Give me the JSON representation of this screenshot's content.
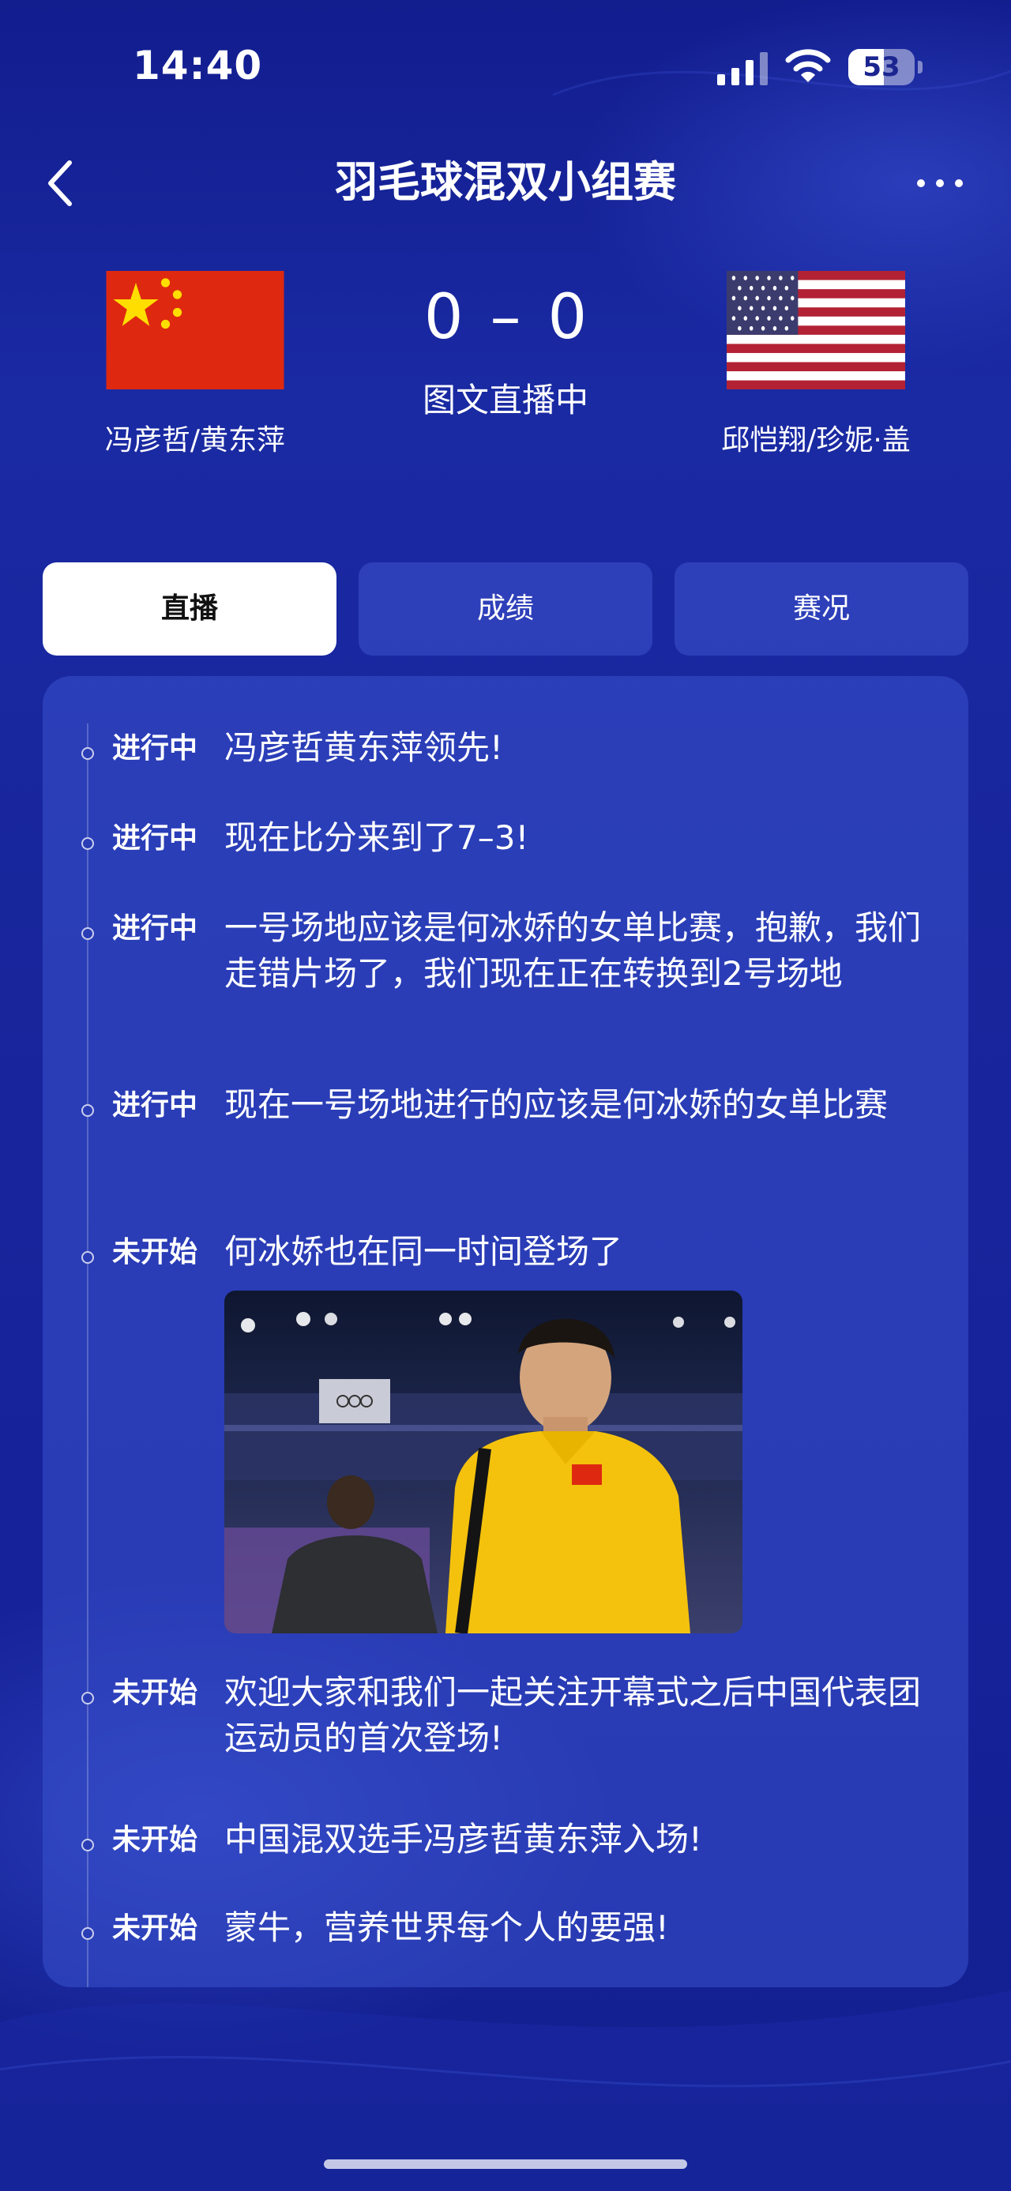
{
  "status_bar": {
    "time": "14:40",
    "battery": "53",
    "battery_level": 0.53
  },
  "nav": {
    "title": "羽毛球混双小组赛"
  },
  "match": {
    "home_team": "冯彦哲/黄东萍",
    "away_team": "邱恺翔/珍妮·盖",
    "home_score": "0",
    "score_separator": "–",
    "away_score": "0",
    "status": "图文直播中"
  },
  "tabs": [
    {
      "label": "直播",
      "active": true
    },
    {
      "label": "成绩",
      "active": false
    },
    {
      "label": "赛况",
      "active": false
    }
  ],
  "feed": [
    {
      "status": "进行中",
      "text": "冯彦哲黄东萍领先!"
    },
    {
      "status": "进行中",
      "text": "现在比分来到了7–3!"
    },
    {
      "status": "进行中",
      "text": "一号场地应该是何冰娇的女单比赛，抱歉，我们走错片场了，我们现在正在转换到2号场地"
    },
    {
      "status": "进行中",
      "text": "现在一号场地进行的应该是何冰娇的女单比赛"
    },
    {
      "status": "未开始",
      "text": "何冰娇也在同一时间登场了"
    },
    {
      "status": "未开始",
      "text": "欢迎大家和我们一起关注开幕式之后中国代表团运动员的首次登场!"
    },
    {
      "status": "未开始",
      "text": "中国混双选手冯彦哲黄东萍入场!"
    },
    {
      "status": "未开始",
      "text": "蒙牛，营养世界每个人的要强!"
    }
  ],
  "colors": {
    "background": "#18259b",
    "card": "#3a52cd",
    "china_red": "#de2910",
    "china_yellow": "#ffde00",
    "usa_red": "#b22234",
    "usa_blue": "#3c3b6e"
  }
}
